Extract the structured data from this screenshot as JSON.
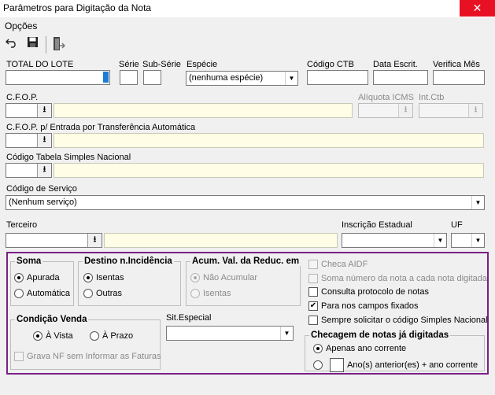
{
  "window": {
    "title": "Parâmetros para Digitação da Nota",
    "close": "✕"
  },
  "menu": {
    "opcoes": "Opções"
  },
  "toolbar": {
    "undo_icon": "undo-icon",
    "save_icon": "save-icon",
    "exit_icon": "exit-icon"
  },
  "fields": {
    "total_lote": "TOTAL DO LOTE",
    "serie": "Série",
    "subserie": "Sub-Série",
    "especie": "Espécie",
    "especie_value": "(nenhuma espécie)",
    "codigo_ctb": "Código CTB",
    "data_escrit": "Data Escrit.",
    "verifica_mes": "Verifica Mês",
    "cfop": "C.F.O.P.",
    "aliquota_icms": "Alíquota ICMS",
    "int_ctb": "Int.Ctb",
    "cfop_transf": "C.F.O.P.  p/ Entrada por Transferência Automática",
    "cod_tab_simples": "Código Tabela Simples Nacional",
    "cod_servico": "Código de Serviço",
    "cod_servico_value": "(Nenhum serviço)",
    "terceiro": "Terceiro",
    "insc_estadual": "Inscrição Estadual",
    "uf": "UF"
  },
  "soma": {
    "title": "Soma",
    "apurada": "Apurada",
    "automatica": "Automática"
  },
  "destino": {
    "title": "Destino n.Incidência",
    "isentas": "Isentas",
    "outras": "Outras"
  },
  "acum": {
    "title": "Acum. Val. da Reduc. em",
    "nao_acumular": "Não Acumular",
    "isentas": "Isentas"
  },
  "condicao": {
    "title": "Condição Venda",
    "a_vista": "À Vista",
    "a_prazo": "À Prazo",
    "grava_nf": "Grava NF sem Informar as Faturas"
  },
  "sit_especial": "Sit.Especial",
  "checks": {
    "checa_aidf": "Checa AIDF",
    "soma_numero": "Soma número da nota a cada nota digitada",
    "consulta_protocolo": "Consulta protocolo de notas",
    "para_campos": "Para nos campos fixados",
    "sempre_solicitar": "Sempre solicitar o código Simples Nacional"
  },
  "checagem": {
    "title": "Checagem de notas já digitadas",
    "apenas": "Apenas ano corrente",
    "anos": "Ano(s) anterior(es) + ano corrente"
  },
  "colors": {
    "highlight": "#7a1f86",
    "yellow_field": "#fffde6",
    "close_red": "#e81123"
  }
}
